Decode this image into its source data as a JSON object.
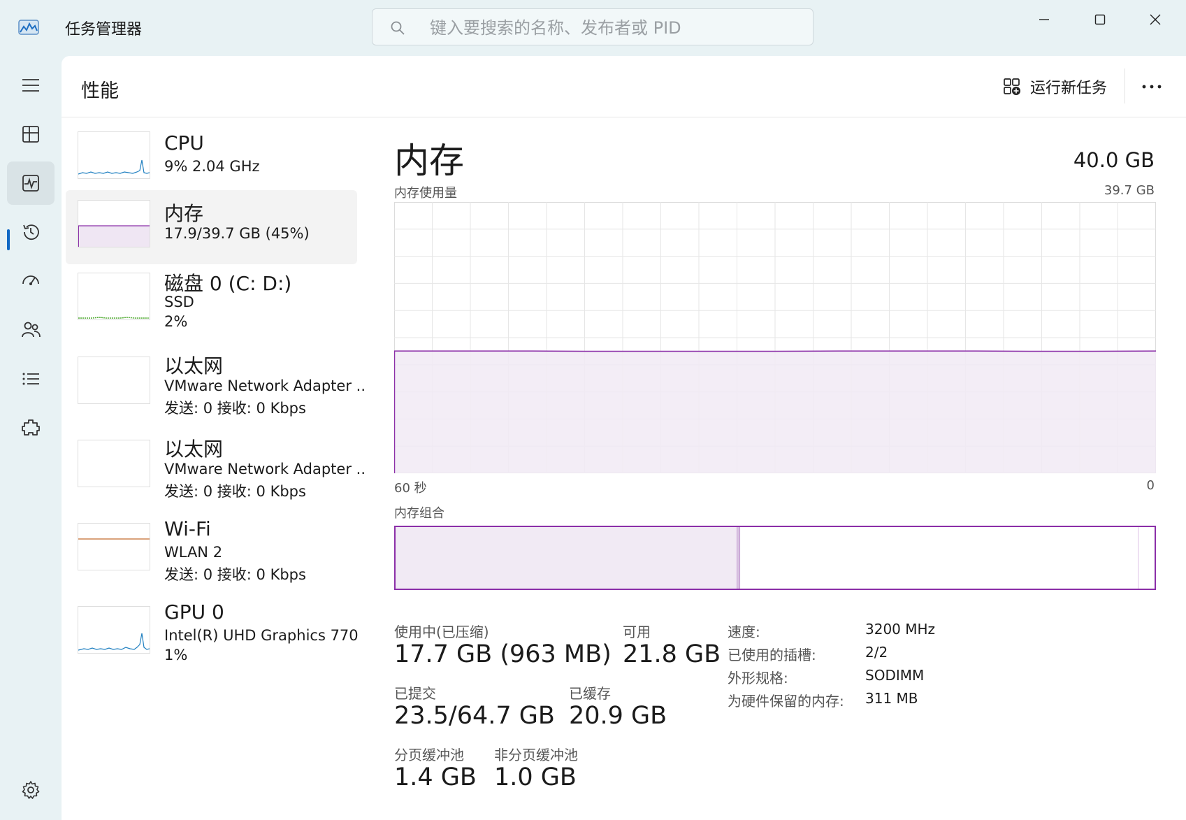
{
  "window": {
    "title": "任务管理器",
    "search_placeholder": "键入要搜索的名称、发布者或 PID"
  },
  "nav": {
    "items": [
      {
        "icon": "hamburger-menu-icon"
      },
      {
        "icon": "processes-icon"
      },
      {
        "icon": "performance-icon",
        "active": true
      },
      {
        "icon": "app-history-icon"
      },
      {
        "icon": "startup-apps-icon"
      },
      {
        "icon": "users-icon"
      },
      {
        "icon": "details-icon"
      },
      {
        "icon": "services-icon"
      },
      {
        "icon": "settings-icon"
      }
    ]
  },
  "header": {
    "page_title": "性能",
    "run_new_task": "运行新任务"
  },
  "sidebar": {
    "items": [
      {
        "title": "CPU",
        "line1": "9%  2.04 GHz",
        "line2": ""
      },
      {
        "title": "内存",
        "line1": "17.9/39.7 GB (45%)",
        "line2": ""
      },
      {
        "title": "磁盘 0 (C: D:)",
        "line1": "SSD",
        "line2": "2%"
      },
      {
        "title": "以太网",
        "line1": "VMware Network Adapter ..",
        "line2": "发送: 0 接收: 0 Kbps"
      },
      {
        "title": "以太网",
        "line1": "VMware Network Adapter ..",
        "line2": "发送: 0 接收: 0 Kbps"
      },
      {
        "title": "Wi-Fi",
        "line1": "WLAN 2",
        "line2": "发送: 0 接收: 0 Kbps"
      },
      {
        "title": "GPU 0",
        "line1": "Intel(R) UHD Graphics 770",
        "line2": "1%"
      }
    ]
  },
  "detail": {
    "title": "内存",
    "total": "40.0 GB",
    "usage_label": "内存使用量",
    "usage_max": "39.7 GB",
    "time_left": "60 秒",
    "time_right": "0",
    "composition_label": "内存组合",
    "stats": {
      "in_use_label": "使用中(已压缩)",
      "in_use_value": "17.7 GB (963 MB)",
      "available_label": "可用",
      "available_value": "21.8 GB",
      "committed_label": "已提交",
      "committed_value": "23.5/64.7 GB",
      "cached_label": "已缓存",
      "cached_value": "20.9 GB",
      "paged_pool_label": "分页缓冲池",
      "paged_pool_value": "1.4 GB",
      "nonpaged_pool_label": "非分页缓冲池",
      "nonpaged_pool_value": "1.0 GB"
    },
    "specs": [
      {
        "label": "速度:",
        "value": "3200 MHz"
      },
      {
        "label": "已使用的插槽:",
        "value": "2/2"
      },
      {
        "label": "外形规格:",
        "value": "SODIMM"
      },
      {
        "label": "为硬件保留的内存:",
        "value": "311 MB"
      }
    ]
  },
  "chart_data": {
    "type": "area",
    "x": [
      60,
      55,
      50,
      45,
      40,
      35,
      30,
      25,
      20,
      15,
      10,
      5,
      0
    ],
    "values": [
      17.9,
      17.9,
      17.9,
      17.85,
      17.85,
      17.85,
      17.85,
      17.9,
      17.9,
      17.9,
      17.85,
      17.85,
      17.9
    ],
    "ylim": [
      0,
      39.7
    ],
    "composition": {
      "in_use_fraction": 0.45,
      "modified_fraction": 0.004,
      "standby_fraction": 0.525,
      "free_fraction": 0.021
    },
    "colors": {
      "memory": "#8b2fa8",
      "fill": "#f1eaf4",
      "grid": "#e6e6e6"
    }
  }
}
